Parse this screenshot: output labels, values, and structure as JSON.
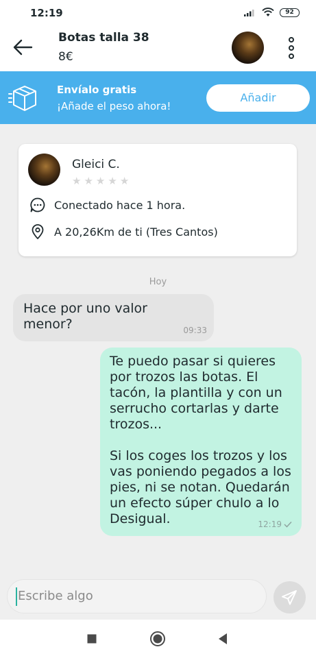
{
  "status_bar": {
    "time": "12:19",
    "battery": "92"
  },
  "header": {
    "title": "Botas talla 38",
    "price": "8€"
  },
  "shipping_banner": {
    "title": "Envíalo gratis",
    "subtitle": "¡Añade el peso ahora!",
    "button_label": "Añadir"
  },
  "seller": {
    "name": "Gleici C.",
    "rating_stars": 0,
    "star_glyphs": [
      "★",
      "★",
      "★",
      "★",
      "★"
    ],
    "last_seen": "Conectado hace 1 hora.",
    "location": "A 20,26Km de ti (Tres Cantos)"
  },
  "date_divider": "Hoy",
  "messages": [
    {
      "direction": "incoming",
      "text": "Hace por uno valor menor?",
      "time": "09:33"
    },
    {
      "direction": "outgoing",
      "text": "Te puedo pasar si quieres por trozos las botas. El tacón, la plantilla y con un serrucho cortarlas y darte trozos...\n\nSi los coges los trozos y los vas poniendo pegados a los pies, ni se notan. Quedarán un efecto súper chulo a lo Desigual.",
      "time": "12:19",
      "status": "sent"
    }
  ],
  "composer": {
    "placeholder": "Escribe algo"
  },
  "colors": {
    "accent_blue": "#49b0ec",
    "outgoing_bubble": "#c2f3e2",
    "incoming_bubble": "#e4e4e4",
    "caret": "#2bb3a0"
  }
}
